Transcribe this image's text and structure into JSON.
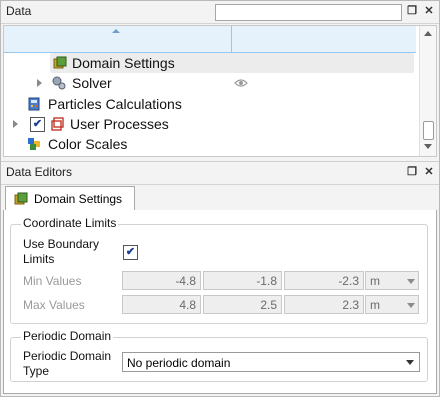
{
  "data_panel": {
    "title": "Data",
    "search": {
      "value": "",
      "placeholder": ""
    },
    "tree": [
      {
        "label": "Domain Settings",
        "icon": "domain-settings-icon",
        "selected": true
      },
      {
        "label": "Solver",
        "icon": "solver-gears-icon",
        "expandable": true,
        "visibility_icon": "eye-icon"
      },
      {
        "label": "Particles Calculations",
        "icon": "particles-calculator-icon"
      },
      {
        "label": "User Processes",
        "icon": "user-processes-icon",
        "expandable": true,
        "checked": true
      },
      {
        "label": "Color Scales",
        "icon": "color-scales-icon"
      }
    ]
  },
  "editors_panel": {
    "title": "Data Editors",
    "active_tab": "Domain Settings",
    "coordinate_limits": {
      "title": "Coordinate Limits",
      "use_boundary_label_line1": "Use Boundary",
      "use_boundary_label_line2": "Limits",
      "use_boundary_checked": true,
      "min_label": "Min Values",
      "min_values": [
        "-4.8",
        "-1.8",
        "-2.3"
      ],
      "min_unit": "m",
      "max_label": "Max Values",
      "max_values": [
        "4.8",
        "2.5",
        "2.3"
      ],
      "max_unit": "m"
    },
    "periodic_domain": {
      "title": "Periodic Domain",
      "type_label_line1": "Periodic Domain",
      "type_label_line2": "Type",
      "type_value": "No periodic domain"
    }
  },
  "colors": {
    "selection": "#ececec",
    "header_highlight": "#e5f1fb",
    "check_mark": "#1b3f8f"
  }
}
